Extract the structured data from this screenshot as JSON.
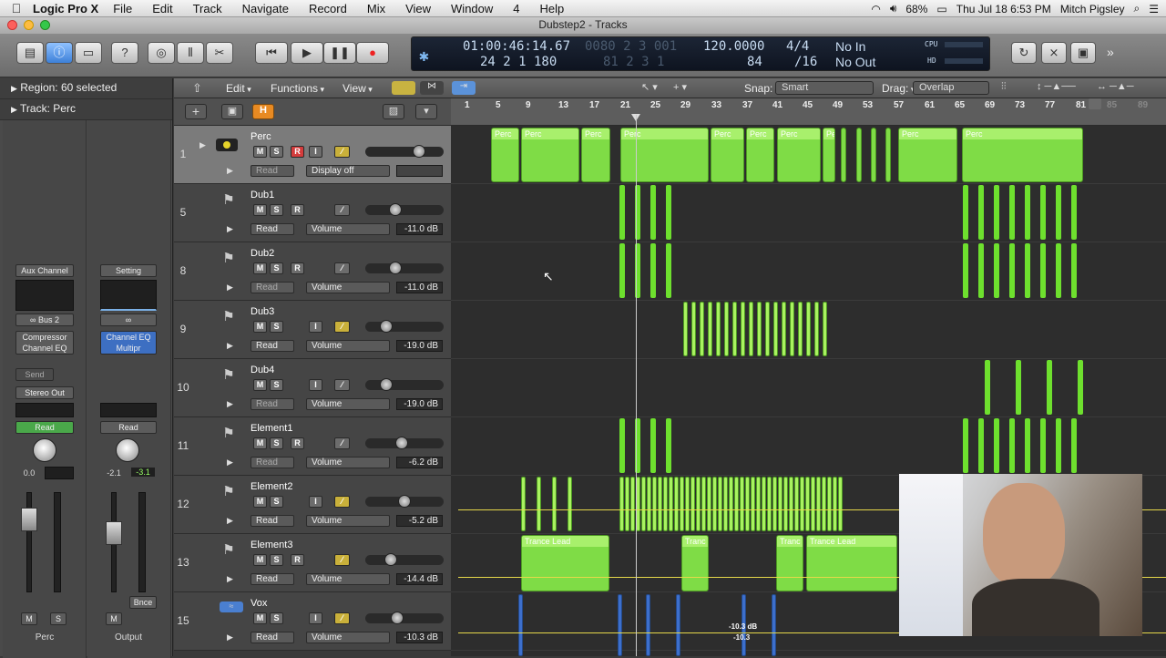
{
  "menubar": {
    "app": "Logic Pro X",
    "items": [
      "File",
      "Edit",
      "Track",
      "Navigate",
      "Record",
      "Mix",
      "View",
      "Window",
      "4",
      "Help"
    ],
    "status": {
      "battery": "68%",
      "datetime": "Thu Jul 18  6:53 PM",
      "user": "Mitch Pigsley"
    }
  },
  "window": {
    "title": "Dubstep2 - Tracks"
  },
  "lcd": {
    "time": "01:00:46:14.67",
    "bars": "24  2  1 180",
    "sub1": "0080  2  3  001",
    "sub2": "81  2  3    1",
    "tempo": "120.0000",
    "tempo2": "84",
    "sig": "4/4",
    "div": "/16",
    "in": "No In",
    "out": "No Out",
    "cpu": "CPU",
    "hd": "HD"
  },
  "inspector": {
    "region": "Region: 60 selected",
    "track": "Track: Perc"
  },
  "strip1": {
    "input": "Aux Channel",
    "send": "Bus 2",
    "plugins": [
      "Compressor",
      "Channel EQ"
    ],
    "sends": "Send",
    "output": "Stereo Out",
    "auto": "Read",
    "pan": "0.0",
    "m": "M",
    "s": "S",
    "name": "Perc"
  },
  "strip2": {
    "setting": "Setting",
    "plugins": [
      "Channel EQ",
      "Multipr"
    ],
    "auto": "Read",
    "vol": "-2.1",
    "peak": "-3.1",
    "bnce": "Bnce",
    "m": "M",
    "name": "Output"
  },
  "localbar": {
    "edit": "Edit",
    "functions": "Functions",
    "view": "View",
    "snap_label": "Snap:",
    "snap": "Smart",
    "drag_label": "Drag:",
    "drag": "Overlap"
  },
  "ruler": [
    "1",
    "5",
    "9",
    "13",
    "17",
    "21",
    "25",
    "29",
    "33",
    "37",
    "41",
    "45",
    "49",
    "53",
    "57",
    "61",
    "65",
    "69",
    "73",
    "77",
    "81",
    "85",
    "89"
  ],
  "tracks": [
    {
      "num": "1",
      "name": "Perc",
      "mode": "Read",
      "param": "Display off",
      "value": ""
    },
    {
      "num": "5",
      "name": "Dub1",
      "mode": "Read",
      "param": "Volume",
      "value": "-11.0 dB"
    },
    {
      "num": "8",
      "name": "Dub2",
      "mode": "Read",
      "param": "Volume",
      "value": "-11.0 dB"
    },
    {
      "num": "9",
      "name": "Dub3",
      "mode": "Read",
      "param": "Volume",
      "value": "-19.0 dB"
    },
    {
      "num": "10",
      "name": "Dub4",
      "mode": "Read",
      "param": "Volume",
      "value": "-19.0 dB"
    },
    {
      "num": "11",
      "name": "Element1",
      "mode": "Read",
      "param": "Volume",
      "value": "-6.2 dB"
    },
    {
      "num": "12",
      "name": "Element2",
      "mode": "Read",
      "param": "Volume",
      "value": "-5.2 dB"
    },
    {
      "num": "13",
      "name": "Element3",
      "mode": "Read",
      "param": "Volume",
      "value": "-14.4 dB"
    },
    {
      "num": "15",
      "name": "Vox",
      "mode": "Read",
      "param": "Volume",
      "value": "-10.3 dB"
    }
  ],
  "regions": {
    "perc": "Perc",
    "trance": "Trance Lead",
    "trance_short": "Tranc",
    "trance2": "Trance Lead",
    "vox_db": "-10.3 dB",
    "vox_db2": "-10.3"
  }
}
